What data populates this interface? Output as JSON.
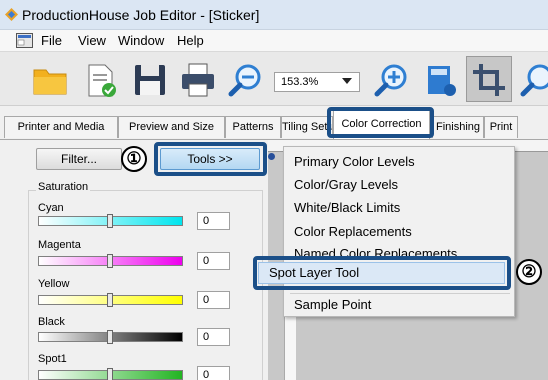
{
  "window": {
    "title": "ProductionHouse Job Editor - [Sticker]"
  },
  "menubar": {
    "items": [
      "File",
      "View",
      "Window",
      "Help"
    ]
  },
  "toolbar": {
    "buttons": [
      "folder-icon",
      "document-check-icon",
      "save-icon",
      "print-icon",
      "zoom-out-icon",
      "zoom-in-icon",
      "bookmark-icon",
      "crop-icon",
      "zoom-icon"
    ],
    "zoom_value": "153.3%"
  },
  "tabs": [
    "Printer and Media",
    "Preview and Size",
    "Patterns",
    "Tiling Setu",
    "Color Correction",
    "Finishing",
    "Print"
  ],
  "active_tab": "Color Correction",
  "panel": {
    "filter_label": "Filter...",
    "tools_label": "Tools >>",
    "group_title": "Saturation",
    "channels": [
      {
        "label": "Cyan",
        "value": "0",
        "color": "#00e5ee"
      },
      {
        "label": "Magenta",
        "value": "0",
        "color": "#ee00ee"
      },
      {
        "label": "Yellow",
        "value": "0",
        "color": "#ffff00"
      },
      {
        "label": "Black",
        "value": "0",
        "color": "#000000"
      },
      {
        "label": "Spot1",
        "value": "0",
        "color": "#22b422"
      }
    ]
  },
  "dropdown": {
    "items": [
      "Primary Color Levels",
      "Color/Gray Levels",
      "White/Black Limits",
      "Color Replacements",
      "Named Color Replacements",
      "Spot Layer Tool",
      "Sample Point"
    ],
    "selected": "Spot Layer Tool"
  },
  "callouts": [
    "①",
    "②"
  ],
  "colors": {
    "highlight": "#1b4f88",
    "menu_selected": "#dbe8f6"
  }
}
